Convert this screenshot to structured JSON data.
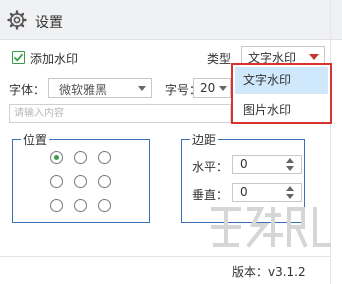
{
  "header": {
    "title": "设置",
    "icon": "gear-icon"
  },
  "add_watermark": {
    "label": "添加水印",
    "checked": true
  },
  "type": {
    "label": "类型",
    "selected": "文字水印",
    "arrow_color": "#c0392b"
  },
  "font": {
    "label": "字体：",
    "selected": "微软雅黑"
  },
  "size": {
    "label": "字号：",
    "selected": "20"
  },
  "content": {
    "placeholder": "请输入内容",
    "value": ""
  },
  "position": {
    "title": "位置",
    "selected_index": 0
  },
  "margin": {
    "title": "边距",
    "horizontal": {
      "label": "水平：",
      "value": "0"
    },
    "vertical": {
      "label": "垂直：",
      "value": "0"
    }
  },
  "dropdown": {
    "options": [
      "文字水印",
      "图片水印"
    ],
    "highlighted_index": 0,
    "border_color": "#d9342b"
  },
  "footer": {
    "version": "版本：v3.1.2"
  },
  "colors": {
    "accent_green": "#3a9e48",
    "group_border": "#3b6fb6",
    "highlight": "#cfe8fb"
  }
}
